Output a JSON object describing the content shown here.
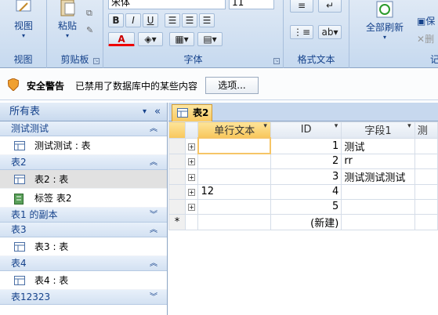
{
  "ribbon": {
    "view_label": "视图",
    "paste_label": "粘贴",
    "font_name": "宋体",
    "font_size": "11",
    "bold": "B",
    "italic": "I",
    "underline": "U",
    "font_color_letter": "A",
    "refresh_label": "全部刷新",
    "save_label": "保",
    "delete_label": "删",
    "groups": {
      "view": "视图",
      "clipboard": "剪贴板",
      "font": "字体",
      "rich_text": "格式文本",
      "records": "记"
    }
  },
  "security": {
    "title": "安全警告",
    "message": "已禁用了数据库中的某些内容",
    "options_button": "选项..."
  },
  "nav": {
    "header": "所有表",
    "groups": [
      {
        "name": "测试测试",
        "items": [
          {
            "label": "测试测试 : 表",
            "kind": "table"
          }
        ]
      },
      {
        "name": "表2",
        "items": [
          {
            "label": "表2 : 表",
            "kind": "table",
            "selected": true
          },
          {
            "label": "标签 表2",
            "kind": "report"
          }
        ]
      },
      {
        "name": "表1 的副本",
        "items": []
      },
      {
        "name": "表3",
        "items": [
          {
            "label": "表3 : 表",
            "kind": "table"
          }
        ]
      },
      {
        "name": "表4",
        "items": [
          {
            "label": "表4 : 表",
            "kind": "table"
          }
        ]
      },
      {
        "name": "表12323",
        "items": []
      }
    ]
  },
  "tab": {
    "label": "表2"
  },
  "grid": {
    "columns": [
      "单行文本",
      "ID",
      "字段1",
      "测"
    ],
    "rows": [
      {
        "c1": "",
        "id": "1",
        "f1": "测试"
      },
      {
        "c1": "",
        "id": "2",
        "f1": "rr"
      },
      {
        "c1": "",
        "id": "3",
        "f1": "测试测试测试"
      },
      {
        "c1": "12",
        "id": "4",
        "f1": ""
      },
      {
        "c1": "",
        "id": "5",
        "f1": ""
      }
    ],
    "new_row_marker": "*",
    "new_row_label": "(新建)"
  },
  "colors": {
    "accent": "#15428b",
    "tab": "#f9c962",
    "ribbon": "#c6d9ef"
  }
}
